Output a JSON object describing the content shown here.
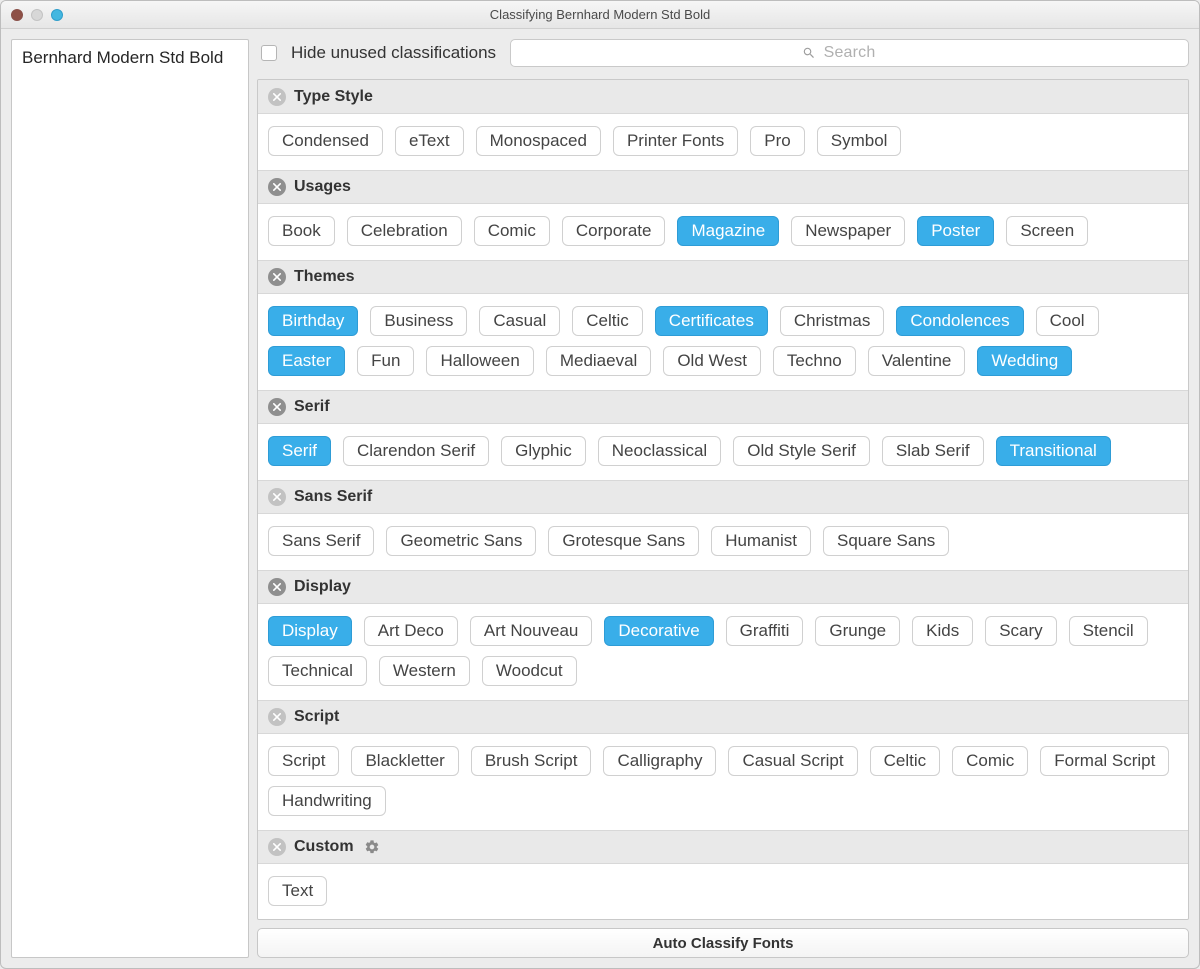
{
  "window": {
    "title": "Classifying Bernhard Modern Std Bold"
  },
  "sidebar": {
    "items": [
      {
        "label": "Bernhard Modern Std Bold"
      }
    ]
  },
  "toolbar": {
    "hide_label": "Hide unused classifications",
    "hide_checked": false,
    "search_placeholder": "Search",
    "search_value": ""
  },
  "groups": [
    {
      "id": "type-style",
      "title": "Type Style",
      "has_selection": false,
      "has_gear": false,
      "tags": [
        {
          "label": "Condensed",
          "selected": false
        },
        {
          "label": "eText",
          "selected": false
        },
        {
          "label": "Monospaced",
          "selected": false
        },
        {
          "label": "Printer Fonts",
          "selected": false
        },
        {
          "label": "Pro",
          "selected": false
        },
        {
          "label": "Symbol",
          "selected": false
        }
      ]
    },
    {
      "id": "usages",
      "title": "Usages",
      "has_selection": true,
      "has_gear": false,
      "tags": [
        {
          "label": "Book",
          "selected": false
        },
        {
          "label": "Celebration",
          "selected": false
        },
        {
          "label": "Comic",
          "selected": false
        },
        {
          "label": "Corporate",
          "selected": false
        },
        {
          "label": "Magazine",
          "selected": true
        },
        {
          "label": "Newspaper",
          "selected": false
        },
        {
          "label": "Poster",
          "selected": true
        },
        {
          "label": "Screen",
          "selected": false
        }
      ]
    },
    {
      "id": "themes",
      "title": "Themes",
      "has_selection": true,
      "has_gear": false,
      "tags": [
        {
          "label": "Birthday",
          "selected": true
        },
        {
          "label": "Business",
          "selected": false
        },
        {
          "label": "Casual",
          "selected": false
        },
        {
          "label": "Celtic",
          "selected": false
        },
        {
          "label": "Certificates",
          "selected": true
        },
        {
          "label": "Christmas",
          "selected": false
        },
        {
          "label": "Condolences",
          "selected": true
        },
        {
          "label": "Cool",
          "selected": false
        },
        {
          "label": "Easter",
          "selected": true
        },
        {
          "label": "Fun",
          "selected": false
        },
        {
          "label": "Halloween",
          "selected": false
        },
        {
          "label": "Mediaeval",
          "selected": false
        },
        {
          "label": "Old West",
          "selected": false
        },
        {
          "label": "Techno",
          "selected": false
        },
        {
          "label": "Valentine",
          "selected": false
        },
        {
          "label": "Wedding",
          "selected": true
        }
      ]
    },
    {
      "id": "serif",
      "title": "Serif",
      "has_selection": true,
      "has_gear": false,
      "tags": [
        {
          "label": "Serif",
          "selected": true
        },
        {
          "label": "Clarendon Serif",
          "selected": false
        },
        {
          "label": "Glyphic",
          "selected": false
        },
        {
          "label": "Neoclassical",
          "selected": false
        },
        {
          "label": "Old Style Serif",
          "selected": false
        },
        {
          "label": "Slab Serif",
          "selected": false
        },
        {
          "label": "Transitional",
          "selected": true
        }
      ]
    },
    {
      "id": "sans-serif",
      "title": "Sans Serif",
      "has_selection": false,
      "has_gear": false,
      "tags": [
        {
          "label": "Sans Serif",
          "selected": false
        },
        {
          "label": "Geometric Sans",
          "selected": false
        },
        {
          "label": "Grotesque Sans",
          "selected": false
        },
        {
          "label": "Humanist",
          "selected": false
        },
        {
          "label": "Square Sans",
          "selected": false
        }
      ]
    },
    {
      "id": "display",
      "title": "Display",
      "has_selection": true,
      "has_gear": false,
      "tags": [
        {
          "label": "Display",
          "selected": true
        },
        {
          "label": "Art Deco",
          "selected": false
        },
        {
          "label": "Art Nouveau",
          "selected": false
        },
        {
          "label": "Decorative",
          "selected": true
        },
        {
          "label": "Graffiti",
          "selected": false
        },
        {
          "label": "Grunge",
          "selected": false
        },
        {
          "label": "Kids",
          "selected": false
        },
        {
          "label": "Scary",
          "selected": false
        },
        {
          "label": "Stencil",
          "selected": false
        },
        {
          "label": "Technical",
          "selected": false
        },
        {
          "label": "Western",
          "selected": false
        },
        {
          "label": "Woodcut",
          "selected": false
        }
      ]
    },
    {
      "id": "script",
      "title": "Script",
      "has_selection": false,
      "has_gear": false,
      "tags": [
        {
          "label": "Script",
          "selected": false
        },
        {
          "label": "Blackletter",
          "selected": false
        },
        {
          "label": "Brush Script",
          "selected": false
        },
        {
          "label": "Calligraphy",
          "selected": false
        },
        {
          "label": "Casual Script",
          "selected": false
        },
        {
          "label": "Celtic",
          "selected": false
        },
        {
          "label": "Comic",
          "selected": false
        },
        {
          "label": "Formal Script",
          "selected": false
        },
        {
          "label": "Handwriting",
          "selected": false
        }
      ]
    },
    {
      "id": "custom",
      "title": "Custom",
      "has_selection": false,
      "has_gear": true,
      "tags": [
        {
          "label": "Text",
          "selected": false
        }
      ]
    }
  ],
  "footer": {
    "auto_label": "Auto Classify Fonts"
  }
}
